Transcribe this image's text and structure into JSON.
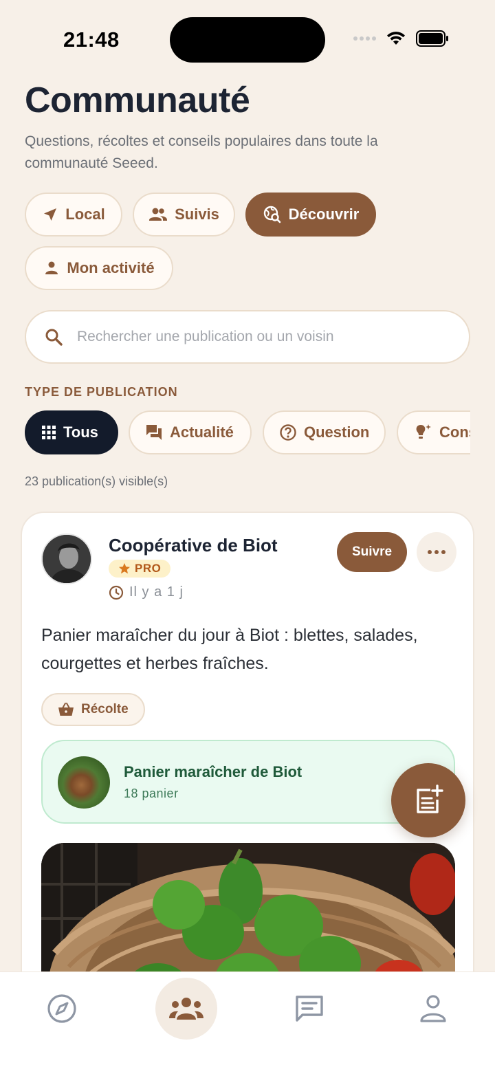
{
  "status_bar": {
    "time": "21:48"
  },
  "header": {
    "title": "Communauté",
    "subtitle": "Questions, récoltes et conseils populaires dans toute la communauté Seeed."
  },
  "scope_filters": [
    {
      "label": "Local",
      "icon": "navigation-arrow-icon",
      "active": false
    },
    {
      "label": "Suivis",
      "icon": "people-icon",
      "active": false
    },
    {
      "label": "Découvrir",
      "icon": "globe-search-icon",
      "active": true
    },
    {
      "label": "Mon activité",
      "icon": "person-icon",
      "active": false
    }
  ],
  "search": {
    "placeholder": "Rechercher une publication ou un voisin",
    "value": ""
  },
  "type_section": {
    "label": "TYPE DE PUBLICATION",
    "chips": [
      {
        "label": "Tous",
        "icon": "grid-icon",
        "active": true
      },
      {
        "label": "Actualité",
        "icon": "chat-bubble-icon",
        "active": false
      },
      {
        "label": "Question",
        "icon": "question-circle-icon",
        "active": false
      },
      {
        "label": "Conseil",
        "icon": "lightbulb-icon",
        "active": false
      }
    ]
  },
  "results_count": "23 publication(s) visible(s)",
  "post": {
    "author": "Coopérative de Biot",
    "badge": "PRO",
    "time_ago": "Il y a 1 j",
    "follow_label": "Suivre",
    "text": "Panier maraîcher du jour à Biot : blettes, salades, courgettes et herbes fraîches.",
    "tag": "Récolte",
    "product": {
      "name": "Panier maraîcher de Biot",
      "quantity": "18 panier"
    }
  },
  "colors": {
    "accent": "#8a5a3a",
    "background": "#f7f0e8",
    "dark": "#131b2b",
    "product_bg": "#eafaf1"
  },
  "tabbar": [
    {
      "icon": "compass-icon",
      "active": false
    },
    {
      "icon": "community-icon",
      "active": true
    },
    {
      "icon": "messages-icon",
      "active": false
    },
    {
      "icon": "profile-icon",
      "active": false
    }
  ]
}
